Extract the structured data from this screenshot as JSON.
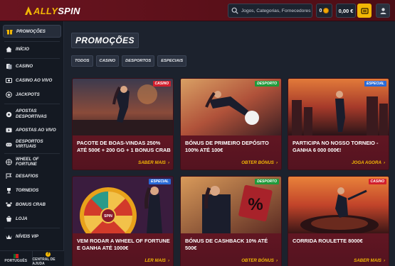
{
  "header": {
    "logo_prefix": "ALLY",
    "logo_suffix": "SPIN",
    "search_placeholder": "Jogos, Categorias, Fornecedores",
    "gg_balance": "0",
    "balance": "0,00 €"
  },
  "sidebar": {
    "items": [
      {
        "label": "PROMOÇÕES",
        "icon": "gift-icon"
      },
      {
        "label": "INÍCIO",
        "icon": "home-icon"
      },
      {
        "label": "CASINO",
        "icon": "cards-icon"
      },
      {
        "label": "CASINO AO VIVO",
        "icon": "live-icon"
      },
      {
        "label": "JACKPOTS",
        "icon": "jackpot-icon"
      },
      {
        "label": "APOSTAS DESPORTIVAS",
        "icon": "sports-icon"
      },
      {
        "label": "APOSTAS AO VIVO",
        "icon": "live-bet-icon"
      },
      {
        "label": "DESPORTOS VIRTUAIS",
        "icon": "virtual-icon"
      },
      {
        "label": "WHEEL OF FORTUNE",
        "icon": "wheel-icon"
      },
      {
        "label": "DESAFIOS",
        "icon": "challenge-icon"
      },
      {
        "label": "TORNEIOS",
        "icon": "trophy-icon"
      },
      {
        "label": "BONUS CRAB",
        "icon": "crab-icon"
      },
      {
        "label": "LOJA",
        "icon": "shop-icon"
      },
      {
        "label": "NÍVEIS VIP",
        "icon": "vip-icon"
      }
    ],
    "footer": {
      "language": "PORTUGUÊS",
      "help": "CENTRAL DE AJUDA"
    }
  },
  "main": {
    "title": "PROMOÇÕES",
    "filters": [
      "TODOS",
      "CASINO",
      "DESPORTOS",
      "ESPECIAIS"
    ],
    "cards": [
      {
        "title": "PACOTE DE BOAS-VINDAS 250% ATÉ 500€ + 200 GG + 1 BONUS CRAB",
        "cta": "SABER MAIS",
        "badge": "CASINO",
        "badge_color": "#d21f2d"
      },
      {
        "title": "BÓNUS DE PRIMEIRO DEPÓSITO 100% ATÉ 100€",
        "cta": "OBTER BÓNUS",
        "badge": "DESPORTO",
        "badge_color": "#1f9a3a"
      },
      {
        "title": "PARTICIPA NO NOSSO TORNEIO - GANHA 6 000 000€!",
        "cta": "JOGA AGORA",
        "badge": "ESPECIAL",
        "badge_color": "#2a6ad6"
      },
      {
        "title": "VEM RODAR A WHEEL OF FORTUNE E GANHA ATÉ 1000€",
        "cta": "LER MAIS",
        "badge": "ESPECIAL",
        "badge_color": "#2a6ad6"
      },
      {
        "title": "BÓNUS DE CASHBACK 10% ATÉ 500€",
        "cta": "OBTER BÓNUS",
        "badge": "DESPORTO",
        "badge_color": "#1f9a3a"
      },
      {
        "title": "CORRIDA ROULETTE 8000€",
        "cta": "SABER MAIS",
        "badge": "CASINO",
        "badge_color": "#d21f2d"
      }
    ]
  },
  "colors": {
    "accent": "#f2b705",
    "card_bg": "#5b1520",
    "sidebar_bg": "#141922"
  }
}
